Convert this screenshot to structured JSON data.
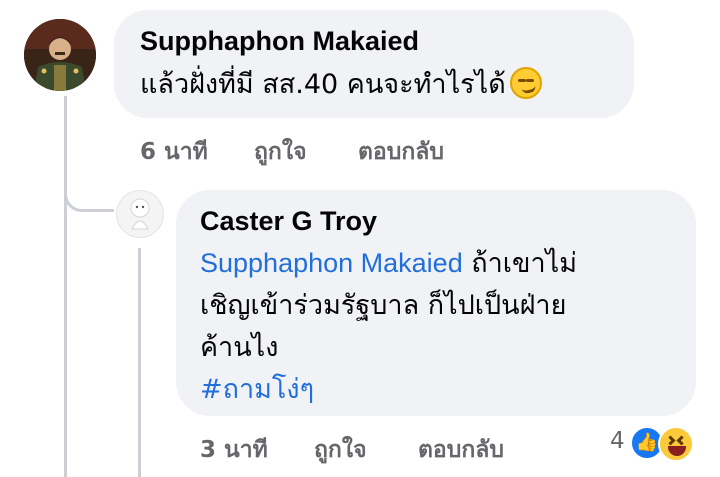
{
  "comment": {
    "author": "Supphaphon Makaied",
    "text": "แล้วฝั่งที่มี สส.40 คนจะทำไรได้",
    "emoji": "smirk-emoji",
    "time": "6 นาที",
    "like_label": "ถูกใจ",
    "reply_label": "ตอบกลับ"
  },
  "reply": {
    "author": "Caster G Troy",
    "mention": "Supphaphon Makaied",
    "line1_rest": " ถ้าเขาไม่",
    "line2": "เชิญเข้าร่วมรัฐบาล ก็ไปเป็นฝ่าย",
    "line3": "ค้านไง",
    "hashtag": "#ถามโง่ๆ",
    "time": "3 นาที",
    "like_label": "ถูกใจ",
    "reply_label": "ตอบกลับ",
    "reaction_count": "4",
    "reactions": [
      "like-icon",
      "haha-icon"
    ]
  },
  "colors": {
    "bubble": "#f0f2f5",
    "link": "#216fdb",
    "meta": "#65676b",
    "like": "#1877f2"
  }
}
